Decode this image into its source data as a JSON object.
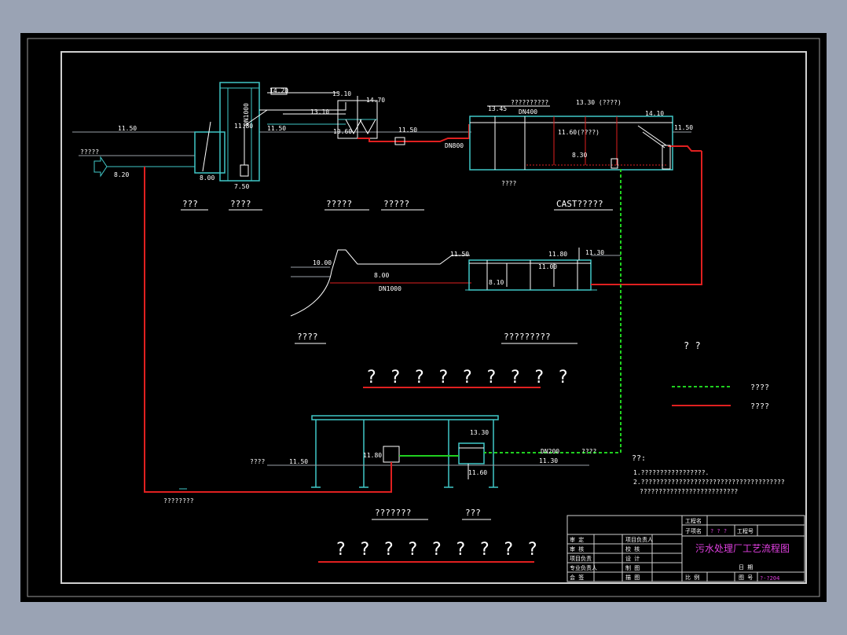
{
  "colors": {
    "background": "#9aa3b4",
    "canvas": "#000000",
    "border": "#cfcfcf",
    "structure": "#40c8c8",
    "sludge_line": "#e02020",
    "air_line": "#20d020",
    "water": "#9aa0a8",
    "title_magenta": "#e040e0"
  },
  "top": {
    "inlet_label": "?????",
    "elev_inlet_water": "11.50",
    "elev_inlet_bottom": "8.20",
    "elev_screen_bottom": "8.00",
    "elev_pump_top": "11.80",
    "elev_pump_bottom": "7.50",
    "pipe_dn1000": "DN1000",
    "elev_1420": "14.20",
    "elev_1310a": "13.10",
    "elev_1150a": "11.50",
    "elev_1310b": "13.10",
    "elev_1470": "14.70",
    "elev_1060": "10.60",
    "elev_1150b": "11.50",
    "pipe_dn800": "DN800",
    "elev_1345": "13.45",
    "cast_note": "??????????",
    "pipe_dn400": "DN400",
    "elev_1330": "13.30 (????)",
    "elev_1410": "14.10",
    "elev_1150c": "11.50",
    "elev_1160": "11.60(????)",
    "elev_830": "8.30",
    "cast_bottom_label": "????",
    "captions": [
      "???",
      "????",
      "?????",
      "?????",
      "CAST?????"
    ]
  },
  "middle": {
    "elev_1000": "10.00",
    "elev_800": "8.00",
    "pipe_dn1000b": "DN1000",
    "elev_1150": "11.50",
    "elev_1180": "11.80",
    "elev_1130": "11.30",
    "elev_1100": "11.00",
    "elev_810": "8.10",
    "captions": [
      "????",
      "?????????"
    ],
    "heading": "? ? ? ? ? ? ? ? ?"
  },
  "legend": {
    "title": "? ?",
    "air": "????",
    "sludge": "????"
  },
  "bottom": {
    "elev_1330": "13.30",
    "elev_1180": "11.80",
    "elev_1150": "11.50",
    "elev_1160": "11.60",
    "elev_1130": "11.30",
    "pipe_dn200": "DN200",
    "pipe_note": "????",
    "left_label": "????",
    "sludge_pipe_label": "????????",
    "captions": [
      "???????",
      "???"
    ],
    "heading": "? ? ? ? ? ? ? ? ?"
  },
  "notes": {
    "title": "??:",
    "line1": "1.?????????????????.",
    "line2": "2.??????????????????????????????????????",
    "line3": "??????????????????????????"
  },
  "titleblock": {
    "project_label": "工程名",
    "sub_label": "子项名",
    "sub_value": "? ? ?",
    "code_label": "工程号",
    "drawing_title": "污水处理厂工艺流程图",
    "date_label": "日 期",
    "number_label": "图 号",
    "number_value": "?-?204",
    "scale_label": "比 例",
    "r1a": "审 定",
    "r1b": "项目负责人",
    "r2a": "审 核",
    "r2b": "校 核",
    "r3a": "项目负责",
    "r3b": "设 计",
    "r4a": "专业负责人",
    "r4b": "制 图",
    "r5a": "会 签",
    "r5b": "描 图"
  }
}
